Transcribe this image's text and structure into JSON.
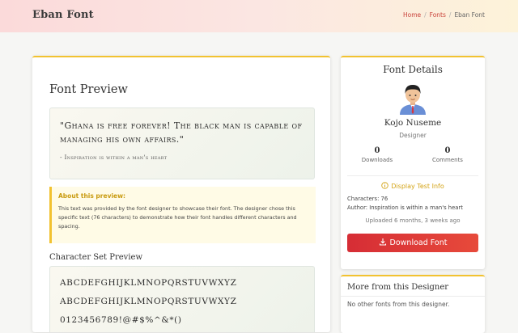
{
  "header": {
    "brand": "Eban Font",
    "breadcrumb": {
      "home": "Home",
      "fonts": "Fonts",
      "current": "Eban Font",
      "separator": "/"
    }
  },
  "preview": {
    "title": "Font Preview",
    "quote": "\"Ghana is free forever! The black man is capable of managing his own affairs.\"",
    "quote_source": "- Inspiration is within a man's heart",
    "about_title": "About this preview:",
    "about_text": "This text was provided by the font designer to showcase their font. The designer chose this specific text (76 characters) to demonstrate how their font handles different characters and spacing.",
    "charset_title": "Character Set Preview",
    "charset": [
      "ABCDEFGHIJKLMNOPQRSTUVWXYZ",
      "ABCDEFGHIJKLMNOPQRSTUVWXYZ",
      "0123456789!@#$%^&*()"
    ]
  },
  "details": {
    "title": "Font Details",
    "designer_name": "Kojo Nuseme",
    "designer_role": "Designer",
    "downloads_count": "0",
    "downloads_label": "Downloads",
    "comments_count": "0",
    "comments_label": "Comments",
    "test_info_label": "Display Test Info",
    "characters_line": "Characters: 76",
    "author_line": "Author: Inspiration is within a man's heart",
    "uploaded": "Uploaded 6 months, 3 weeks ago",
    "download_label": "Download Font"
  },
  "more": {
    "title": "More from this Designer",
    "empty_text": "No other fonts from this designer."
  },
  "colors": {
    "accent": "#f2c230",
    "download_button": "#e03a36",
    "breadcrumb_link": "#c9423a"
  }
}
